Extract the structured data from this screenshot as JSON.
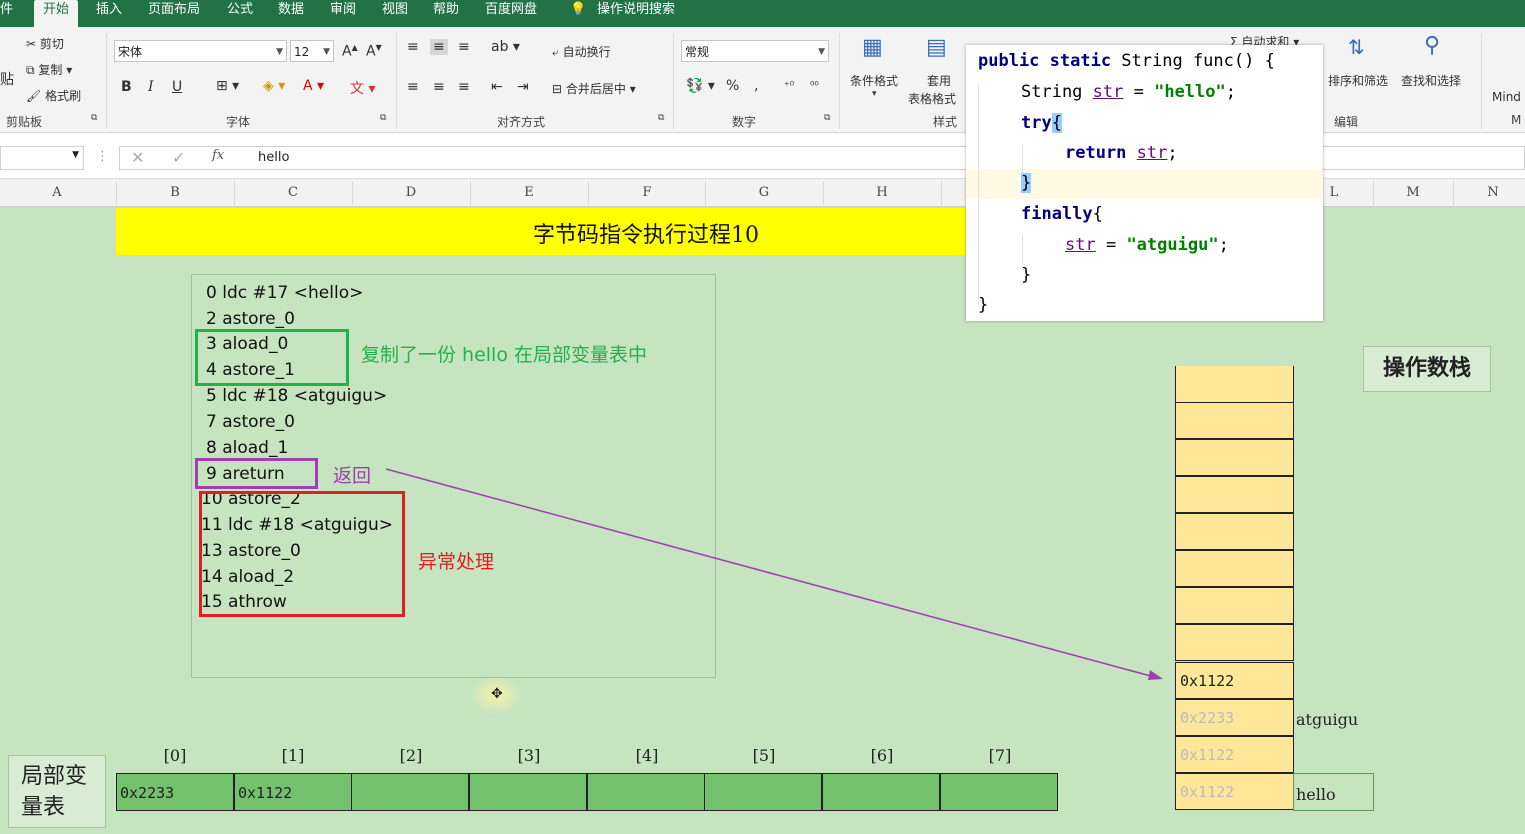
{
  "ribbon_tabs": [
    "件",
    "开始",
    "插入",
    "页面布局",
    "公式",
    "数据",
    "审阅",
    "视图",
    "帮助",
    "百度网盘",
    "操作说明搜索"
  ],
  "ribbon": {
    "clipboard": {
      "cut": "剪切",
      "copy": "复制",
      "format_painter": "格式刷",
      "paste_partial": "贴",
      "group": "剪贴板"
    },
    "font": {
      "name": "宋体",
      "size": "12",
      "bold": "B",
      "italic": "I",
      "underline": "U",
      "group": "字体"
    },
    "align": {
      "wrap": "自动换行",
      "merge": "合并后居中",
      "group": "对齐方式"
    },
    "number": {
      "format": "常规",
      "group": "数字"
    },
    "styles": {
      "cond": "条件格式",
      "table": "套用",
      "table2": "表格格式",
      "group": "样式"
    },
    "edit": {
      "autosum": "自动求和",
      "sort": "排序和筛选",
      "find": "查找和选择",
      "group": "编辑",
      "mind": "Mind",
      "m": "M"
    }
  },
  "formula_bar": {
    "fx": "fx",
    "value": "hello"
  },
  "columns": [
    "A",
    "B",
    "C",
    "D",
    "E",
    "F",
    "G",
    "H",
    "L",
    "M",
    "N"
  ],
  "sheet_title": "字节码指令执行过程10",
  "bytecode": [
    "0 ldc #17 <hello>",
    "2 astore_0",
    "3 aload_0",
    "4 astore_1",
    "5 ldc #18 <atguigu>",
    "7 astore_0",
    "8 aload_1",
    "9 areturn",
    "10 astore_2",
    "11 ldc #18 <atguigu>",
    "13 astore_0",
    "14 aload_2",
    "15 athrow"
  ],
  "annotations": {
    "copy": "复制了一份 hello 在局部变量表中",
    "return": "返回",
    "exception": "异常处理"
  },
  "annotation_colors": {
    "copy": "#22b24c",
    "return": "#a040b0",
    "exception": "#e02020"
  },
  "code": {
    "line1a": "public static",
    "line1b": " String func() {",
    "line2a": "String ",
    "line2var": "str",
    "line2b": " = ",
    "line2str": "\"hello\"",
    "line2c": ";",
    "line3a": "try",
    "line3b": "{",
    "line4a": "return ",
    "line4var": "str",
    "line4b": ";",
    "line5": "}",
    "line6a": "finally",
    "line6b": "{",
    "line7var": "str",
    "line7b": " = ",
    "line7str": "\"atguigu\"",
    "line7c": ";",
    "line8": "}",
    "line9": "}"
  },
  "operand_stack": {
    "label": "操作数栈",
    "active": "0x1122",
    "faded": [
      "0x2233",
      "0x1122",
      "0x1122"
    ],
    "side_labels": [
      "atguigu",
      "hello"
    ]
  },
  "local_vars": {
    "label_line1": "局部变",
    "label_line2": "量表",
    "indices": [
      "[0]",
      "[1]",
      "[2]",
      "[3]",
      "[4]",
      "[5]",
      "[6]",
      "[7]"
    ],
    "values": [
      "0x2233",
      "0x1122",
      "",
      "",
      "",
      "",
      "",
      ""
    ]
  }
}
